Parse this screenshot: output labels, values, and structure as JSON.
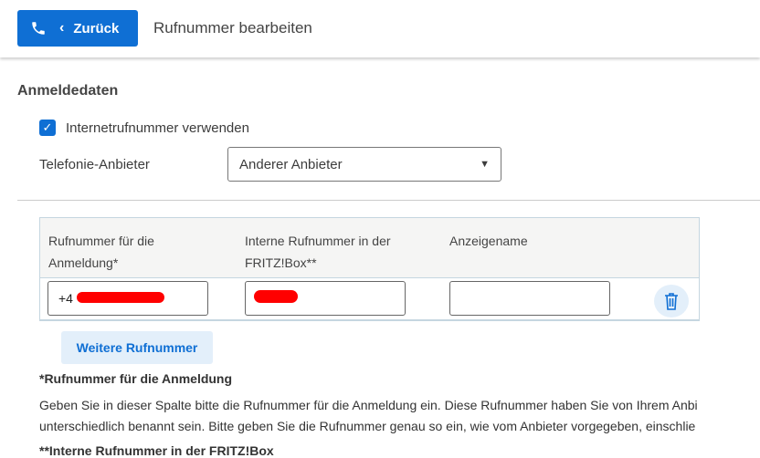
{
  "header": {
    "back_label": "Zurück",
    "title": "Rufnummer bearbeiten"
  },
  "section": {
    "title": "Anmeldedaten",
    "checkbox_label": "Internetrufnummer verwenden",
    "checkbox_checked": true,
    "provider_label": "Telefonie-Anbieter",
    "provider_value": "Anderer Anbieter"
  },
  "table": {
    "headers": [
      "Rufnummer für die Anmeldung*",
      "Interne Rufnummer in der FRITZ!Box**",
      "Anzeigename"
    ],
    "row": {
      "number": "+4",
      "internal": "",
      "display_name": ""
    }
  },
  "add_button": "Weitere Rufnummer",
  "notes": {
    "n1_title": "*Rufnummer für die Anmeldung",
    "n1_line1": "Geben Sie in dieser Spalte bitte die Rufnummer für die Anmeldung ein. Diese Rufnummer haben Sie von Ihrem Anbi",
    "n1_line2": "unterschiedlich benannt sein. Bitte geben Sie die Rufnummer genau so ein, wie vom Anbieter vorgegeben, einschlie",
    "n2_title": "**Interne Rufnummer in der FRITZ!Box"
  }
}
